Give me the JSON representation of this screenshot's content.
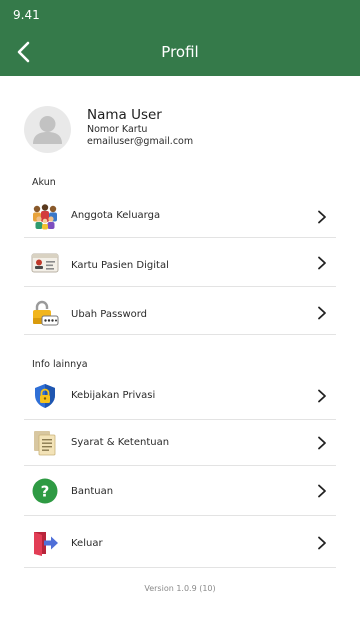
{
  "status_bar": {
    "time": "9.41"
  },
  "header": {
    "title": "Profil",
    "back_icon": "chevron-left-icon"
  },
  "user": {
    "name": "Nama User",
    "card_label": "Nomor Kartu",
    "email": "emailuser@gmail.com"
  },
  "sections": [
    {
      "label": "Akun",
      "items": [
        {
          "label": "Anggota Keluarga",
          "icon": "family-icon"
        },
        {
          "label": "Kartu Pasien Digital",
          "icon": "patient-card-icon"
        },
        {
          "label": "Ubah Password",
          "icon": "padlock-icon"
        }
      ]
    },
    {
      "label": "Info lainnya",
      "items": [
        {
          "label": "Kebijakan Privasi",
          "icon": "privacy-shield-icon"
        },
        {
          "label": "Syarat & Ketentuan",
          "icon": "terms-document-icon"
        },
        {
          "label": "Bantuan",
          "icon": "help-icon"
        },
        {
          "label": "Keluar",
          "icon": "logout-icon"
        }
      ]
    }
  ],
  "footer": {
    "version": "Version 1.0.9 (10)"
  },
  "colors": {
    "primary": "#357a4a",
    "background": "#ffffff",
    "divider": "#e3e3e3"
  }
}
